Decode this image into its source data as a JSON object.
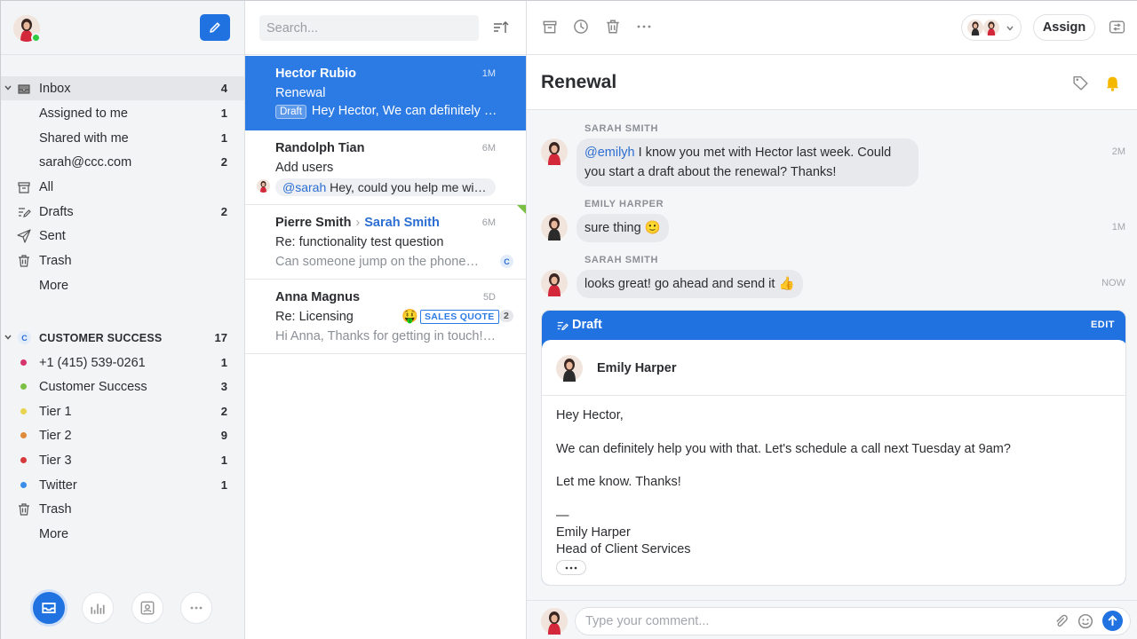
{
  "sidebar": {
    "compose_icon": "pencil-icon",
    "items": [
      {
        "label": "Inbox",
        "count": "4"
      },
      {
        "label": "Assigned to me",
        "count": "1"
      },
      {
        "label": "Shared with me",
        "count": "1"
      },
      {
        "label": "sarah@ccc.com",
        "count": "2"
      },
      {
        "label": "All",
        "count": ""
      },
      {
        "label": "Drafts",
        "count": "2"
      },
      {
        "label": "Sent",
        "count": ""
      },
      {
        "label": "Trash",
        "count": ""
      },
      {
        "label": "More",
        "count": ""
      }
    ],
    "team": {
      "badge": "C",
      "title": "CUSTOMER SUCCESS",
      "count": "17",
      "items": [
        {
          "label": "+1 (415) 539-0261",
          "count": "1",
          "color": "#d6336c"
        },
        {
          "label": "Customer Success",
          "count": "3",
          "color": "#7bc043"
        },
        {
          "label": "Tier 1",
          "count": "2",
          "color": "#e8d44d"
        },
        {
          "label": "Tier 2",
          "count": "9",
          "color": "#e08a3c"
        },
        {
          "label": "Tier 3",
          "count": "1",
          "color": "#d63b3b"
        },
        {
          "label": "Twitter",
          "count": "1",
          "color": "#3b8ee8"
        },
        {
          "label": "Trash",
          "count": ""
        },
        {
          "label": "More",
          "count": ""
        }
      ]
    }
  },
  "list": {
    "search_placeholder": "Search...",
    "conversations": [
      {
        "name": "Hector Rubio",
        "time": "1M",
        "subject": "Renewal",
        "tag": "Draft",
        "preview": "Hey Hector, We can definitely help you with that"
      },
      {
        "name": "Randolph Tian",
        "time": "6M",
        "subject": "Add users",
        "mention": "@sarah",
        "preview": " Hey, could you help me with this?"
      },
      {
        "name": "Pierre Smith",
        "to": "Sarah Smith",
        "time": "6M",
        "subject": "Re: functionality test question",
        "preview": "Can someone jump on the phone with me",
        "badge": "C"
      },
      {
        "name": "Anna Magnus",
        "time": "5D",
        "subject": "Re: Licensing",
        "emoji": "🤑",
        "tag": "SALES QUOTE",
        "count": "2",
        "preview": "Hi Anna, Thanks for getting in touch! We"
      }
    ]
  },
  "main": {
    "assign_label": "Assign",
    "title": "Renewal",
    "messages": [
      {
        "author": "SARAH SMITH",
        "mention": "@emilyh",
        "text": " I know you met with Hector last week. Could you start a draft about the renewal? Thanks!",
        "time": "2M"
      },
      {
        "author": "EMILY HARPER",
        "text": "sure thing 🙂",
        "time": "1M"
      },
      {
        "author": "SARAH SMITH",
        "text": "looks great! go ahead and send it 👍",
        "time": "NOW"
      }
    ],
    "draft": {
      "label": "Draft",
      "edit": "EDIT",
      "from": "Emily Harper",
      "greeting": "Hey Hector,",
      "body": "We can definitely help you with that. Let's schedule a call next Tuesday at 9am?",
      "closing": "Let me know. Thanks!",
      "sig_dash": "—",
      "sig_name": "Emily Harper",
      "sig_title": "Head of Client Services"
    },
    "comment_placeholder": "Type your comment..."
  }
}
